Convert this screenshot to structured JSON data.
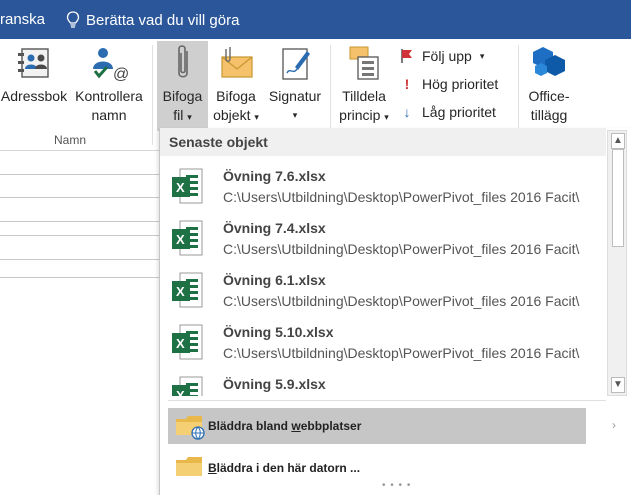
{
  "titlebar": {
    "partial_text": "ranska",
    "tell_me": "Berätta vad du vill göra"
  },
  "ribbon": {
    "adressbok": "Adressbok",
    "kontrollera_line1": "Kontrollera",
    "kontrollera_line2": "namn",
    "namn_group": "Namn",
    "bifoga_fil_line1": "Bifoga",
    "bifoga_fil_line2": "fil",
    "bifoga_objekt_line1": "Bifoga",
    "bifoga_objekt_line2": "objekt",
    "signatur": "Signatur",
    "tilldela_line1": "Tilldela",
    "tilldela_line2": "princip",
    "folj_upp": "Följ upp",
    "hog_prioritet": "Hög prioritet",
    "lag_prioritet": "Låg prioritet",
    "office_line1": "Office-",
    "office_line2": "tillägg"
  },
  "dropdown": {
    "header": "Senaste objekt",
    "items": [
      {
        "name": "Övning 7.6.xlsx",
        "path": "C:\\Users\\Utbildning\\Desktop\\PowerPivot_files 2016 Facit\\"
      },
      {
        "name": "Övning 7.4.xlsx",
        "path": "C:\\Users\\Utbildning\\Desktop\\PowerPivot_files 2016 Facit\\"
      },
      {
        "name": "Övning 6.1.xlsx",
        "path": "C:\\Users\\Utbildning\\Desktop\\PowerPivot_files 2016 Facit\\"
      },
      {
        "name": "Övning 5.10.xlsx",
        "path": "C:\\Users\\Utbildning\\Desktop\\PowerPivot_files 2016 Facit\\"
      },
      {
        "name": "Övning 5.9.xlsx",
        "path": ""
      }
    ],
    "browse_web_pre": "Bläddra bland ",
    "browse_web_key": "w",
    "browse_web_post": "ebbplatser",
    "browse_pc_key": "B",
    "browse_pc_post": "läddra i den här datorn ..."
  },
  "colors": {
    "titlebar": "#2b579a",
    "excel_green": "#1e7145",
    "active_button": "#cfcfcf",
    "hover_row": "#c6c6c6"
  }
}
